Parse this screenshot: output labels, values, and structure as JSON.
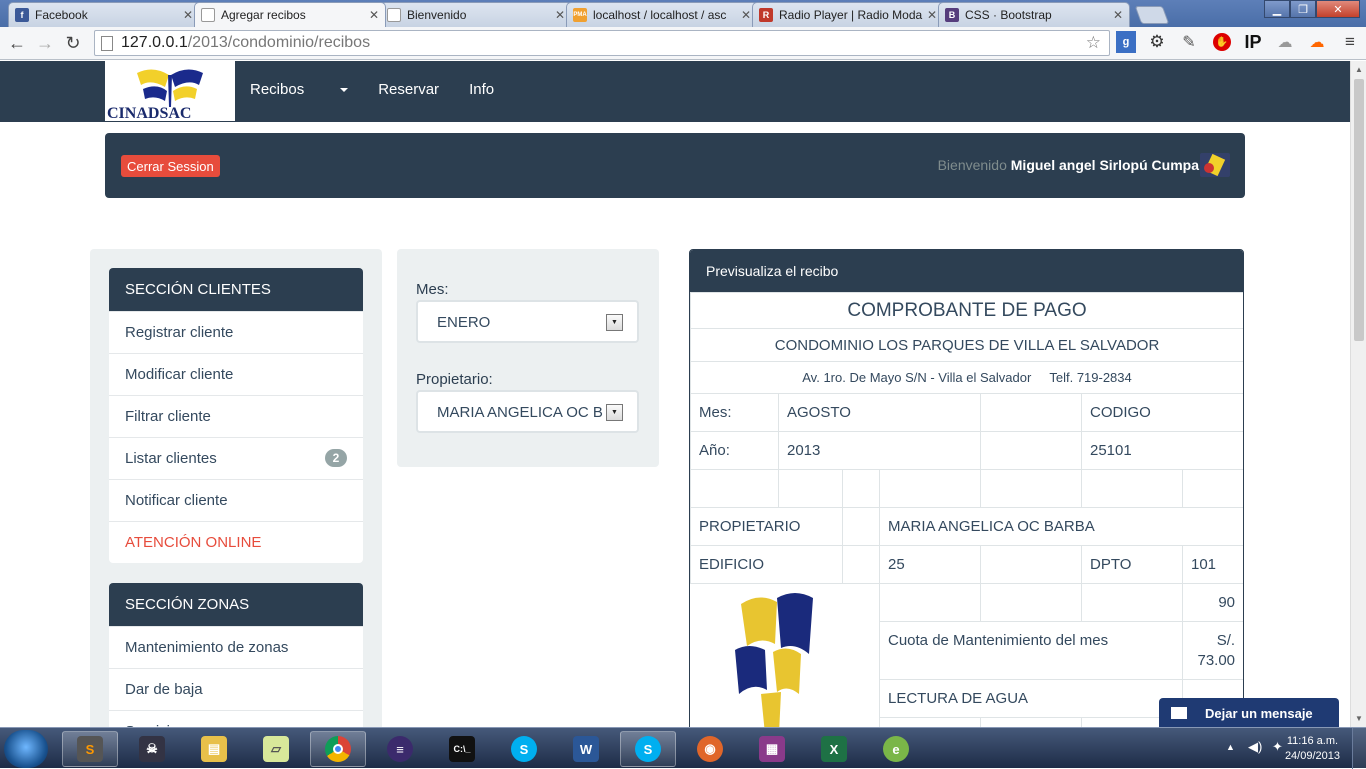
{
  "browser": {
    "tabs": [
      {
        "label": "Facebook",
        "icon": "facebook-icon",
        "color": "#3b5998",
        "glyph": "f"
      },
      {
        "label": "Agregar recibos",
        "icon": "document-icon",
        "color": "#ffffff",
        "glyph": ""
      },
      {
        "label": "Bienvenido",
        "icon": "document-icon",
        "color": "#ffffff",
        "glyph": ""
      },
      {
        "label": "localhost / localhost / asc",
        "icon": "phpmyadmin-icon",
        "color": "#f0a030",
        "glyph": "PMA"
      },
      {
        "label": "Radio Player | Radio Moda",
        "icon": "radio-icon",
        "color": "#c0392b",
        "glyph": "R"
      },
      {
        "label": "CSS · Bootstrap",
        "icon": "bootstrap-icon",
        "color": "#563d7c",
        "glyph": "B"
      }
    ],
    "url_host": "127.0.0.1",
    "url_path": "/2013/condominio/recibos"
  },
  "navbar": {
    "logo_text": "CINADSAC",
    "menu": [
      "Recibos",
      "Reservar",
      "Info"
    ]
  },
  "welcome": {
    "logout": "Cerrar Session",
    "greeting": "Bienvenido",
    "user": "Miguel angel Sirlopú Cumpa"
  },
  "sidebar": {
    "clients_title": "SECCIÓN CLIENTES",
    "clients": [
      "Registrar cliente",
      "Modificar cliente",
      "Filtrar cliente",
      "Listar clientes",
      "Notificar cliente",
      "ATENCIÓN ONLINE"
    ],
    "clients_badge": "2",
    "zones_title": "SECCIÓN ZONAS",
    "zones": [
      "Mantenimiento de zonas",
      "Dar de baja",
      "Servicios"
    ]
  },
  "form": {
    "mes_label": "Mes:",
    "mes_value": "ENERO",
    "prop_label": "Propietario:",
    "prop_value": "MARIA ANGELICA OC B"
  },
  "receipt": {
    "panel_title": "Previsualiza el recibo",
    "title": "COMPROBANTE DE PAGO",
    "condo": "CONDOMINIO LOS PARQUES DE VILLA EL SALVADOR",
    "address": "Av. 1ro. De Mayo S/N - Villa el Salvador",
    "phone": "Telf. 719-2834",
    "mes_label": "Mes:",
    "mes_value": "AGOSTO",
    "codigo_label": "CODIGO",
    "anio_label": "Año:",
    "anio_value": "2013",
    "codigo_value": "25101",
    "prop_label": "PROPIETARIO",
    "prop_value": "MARIA ANGELICA OC BARBA",
    "edif_label": "EDIFICIO",
    "edif_value": "25",
    "dpto_label": "DPTO",
    "dpto_value": "101",
    "amount_top": "90",
    "cuota_label": "Cuota de Mantenimiento del mes",
    "cuota_value": "S/. 73.00",
    "agua_label": "LECTURA DE AGUA"
  },
  "feedback": {
    "label": "Dejar un mensaje"
  },
  "taskbar": {
    "time": "11:16 a.m.",
    "date": "24/09/2013"
  },
  "colors": {
    "navy": "#2c3e50",
    "danger": "#e74c3c",
    "well": "#ecf0f1"
  }
}
